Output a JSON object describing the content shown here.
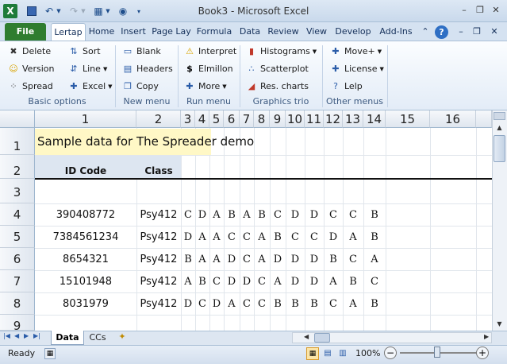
{
  "window": {
    "title": "Book3 - Microsoft Excel",
    "app_icon": "X",
    "minimize": "–",
    "restore": "❐",
    "close": "✕"
  },
  "tabs": [
    "File",
    "Lertap",
    "Home",
    "Insert",
    "Page Lay",
    "Formula",
    "Data",
    "Review",
    "View",
    "Develop",
    "Add-Ins"
  ],
  "ribbon": {
    "basic": {
      "label": "Basic options",
      "delete": "Delete",
      "version": "Version",
      "spread": "Spread",
      "sort": "Sort",
      "line": "Line",
      "excel": "Excel"
    },
    "new": {
      "label": "New menu",
      "blank": "Blank",
      "headers": "Headers",
      "copy": "Copy"
    },
    "run": {
      "label": "Run menu",
      "interpret": "Interpret",
      "elmillon": "Elmillon",
      "more": "More"
    },
    "graphics": {
      "label": "Graphics trio",
      "histograms": "Histograms",
      "scatterplot": "Scatterplot",
      "res_charts": "Res. charts"
    },
    "other": {
      "label": "Other menus",
      "move": "Move+",
      "license": "License",
      "lelp": "Lelp"
    }
  },
  "sheet": {
    "columns": [
      "1",
      "2",
      "3",
      "4",
      "5",
      "6",
      "7",
      "8",
      "9",
      "10",
      "11",
      "12",
      "13",
      "14",
      "15",
      "16"
    ],
    "rows": [
      "1",
      "2",
      "3",
      "4",
      "5",
      "6",
      "7",
      "8",
      "9"
    ],
    "title_text": "Sample data for The Spreader demo",
    "header_id": "ID Code",
    "header_class": "Class",
    "records": [
      {
        "id": "390408772",
        "class": "Psy412",
        "answers": [
          "C",
          "D",
          "A",
          "B",
          "A",
          "B",
          "C",
          "D",
          "D",
          "C",
          "C",
          "B"
        ]
      },
      {
        "id": "7384561234",
        "class": "Psy412",
        "answers": [
          "D",
          "A",
          "A",
          "C",
          "C",
          "A",
          "B",
          "C",
          "C",
          "D",
          "A",
          "B"
        ]
      },
      {
        "id": "8654321",
        "class": "Psy412",
        "answers": [
          "B",
          "A",
          "A",
          "D",
          "C",
          "A",
          "D",
          "D",
          "D",
          "B",
          "C",
          "A"
        ]
      },
      {
        "id": "15101948",
        "class": "Psy412",
        "answers": [
          "A",
          "B",
          "C",
          "D",
          "D",
          "C",
          "A",
          "D",
          "D",
          "A",
          "B",
          "C"
        ]
      },
      {
        "id": "8031979",
        "class": "Psy412",
        "answers": [
          "D",
          "C",
          "D",
          "A",
          "C",
          "C",
          "B",
          "B",
          "B",
          "C",
          "A",
          "B"
        ]
      }
    ]
  },
  "sheet_tabs": [
    "Data",
    "CCs"
  ],
  "status": {
    "ready": "Ready",
    "zoom": "100%"
  },
  "colors": {
    "file_tab": "#2f7d2f",
    "title_cell": "#fff8c6",
    "header_cell": "#dde6f1"
  }
}
